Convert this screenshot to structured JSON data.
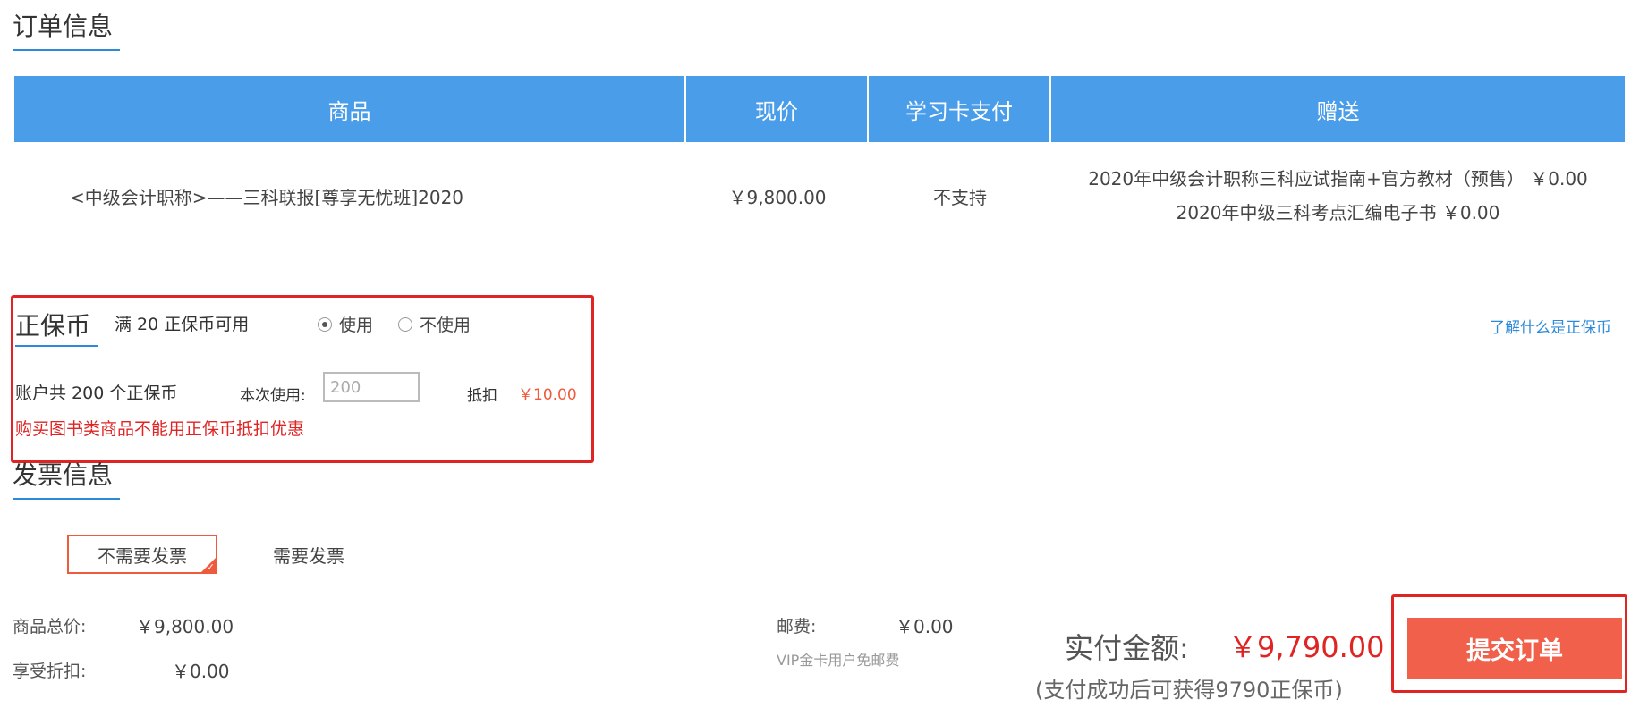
{
  "order": {
    "title": "订单信息",
    "headers": {
      "product": "商品",
      "price": "现价",
      "card_pay": "学习卡支付",
      "gift": "赠送"
    },
    "row": {
      "product": "<中级会计职称>——三科联报[尊享无忧班]2020",
      "price": "￥9,800.00",
      "card_pay": "不支持",
      "gifts": [
        "2020年中级会计职称三科应试指南+官方教材（预售） ￥0.00",
        "2020年中级三科考点汇编电子书 ￥0.00"
      ]
    }
  },
  "coin": {
    "title": "正保币",
    "threshold": "满 20 正保币可用",
    "use_label": "使用",
    "no_use_label": "不使用",
    "use_selected": true,
    "help_link": "了解什么是正保币",
    "balance": "账户共 200 个正保币",
    "this_use_label": "本次使用:",
    "this_use_value": "200",
    "deduct_label": "抵扣",
    "deduct_value": "￥10.00",
    "warning": "购买图书类商品不能用正保币抵扣优惠"
  },
  "invoice": {
    "title": "发票信息",
    "option_none": "不需要发票",
    "option_need": "需要发票",
    "selected": "option_none"
  },
  "summary": {
    "total_label": "商品总价:",
    "total_value": "￥9,800.00",
    "discount_label": "享受折扣:",
    "discount_value": "￥0.00",
    "shipping_label": "邮费:",
    "shipping_value": "￥0.00",
    "vip_note": "VIP金卡用户免邮费",
    "pay_label": "实付金额:",
    "pay_amount": "￥9,790.00",
    "pay_note": "(支付成功后可获得9790正保币)",
    "submit_label": "提交订单"
  },
  "colors": {
    "header_bg": "#4a9de8",
    "accent_red": "#e02424",
    "accent_orange": "#f0604a",
    "link_blue": "#2e8ad8"
  }
}
